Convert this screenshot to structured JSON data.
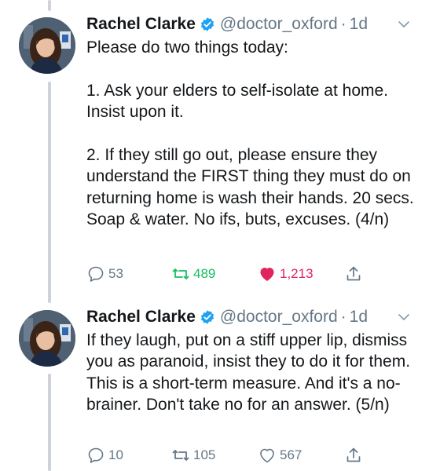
{
  "tweets": [
    {
      "author_name": "Rachel Clarke",
      "handle": "@doctor_oxford",
      "separator": "·",
      "time": "1d",
      "verified_icon": "verified-badge-icon",
      "text": "Please do two things today:\n\n1. Ask your elders to self-isolate at home. Insist upon it.\n\n2. If they still go out, please ensure they understand the FIRST thing they must do on returning home is wash their hands. 20 secs. Soap & water. No ifs, buts, excuses. (4/n)",
      "replies": "53",
      "retweets": "489",
      "likes": "1,213",
      "retweeted": true,
      "liked": true
    },
    {
      "author_name": "Rachel Clarke",
      "handle": "@doctor_oxford",
      "separator": "·",
      "time": "1d",
      "verified_icon": "verified-badge-icon",
      "text": "If they laugh, put on a stiff upper lip, dismiss you as paranoid, insist they to do it for them. This is a short-term measure. And it's a no-brainer. Don't take no for an answer. (5/n)",
      "replies": "10",
      "retweets": "105",
      "likes": "567",
      "retweeted": false,
      "liked": false
    }
  ],
  "colors": {
    "text": "#14171a",
    "secondary": "#657786",
    "verified": "#1da1f2",
    "retweet_active": "#17bf63",
    "like_active": "#e0245e",
    "thread_line": "#cdd3d8"
  }
}
